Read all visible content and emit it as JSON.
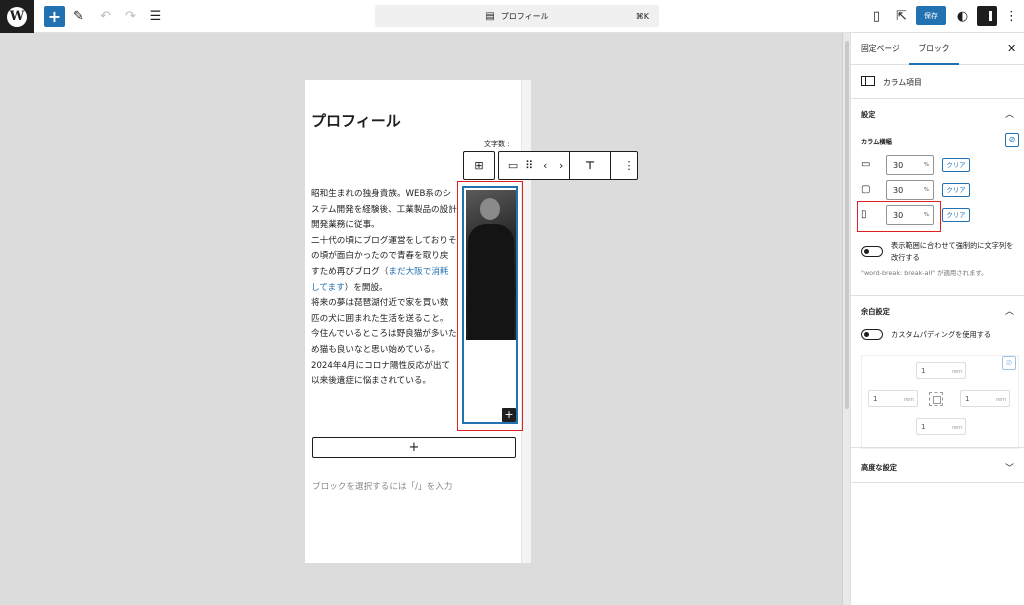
{
  "topbar": {
    "logo_letter": "W",
    "add_symbol": "+",
    "doc_title": "プロフィール",
    "shortcut": "⌘K",
    "save_label": "保存"
  },
  "editor": {
    "page_title": "プロフィール",
    "word_count_label": "文字数 :",
    "profile_paragraphs": [
      "昭和生まれの独身貴族。WEB系のシステム開発を経験後、工業製品の設計開発業務に従事。",
      "二十代の頃にブログ運営をしておりその頃が面白かったので青春を取り戻すため再びブログ（",
      "まだ大阪で消耗してます",
      "）を開設。",
      "将来の夢は琵琶湖付近で家を買い数匹の犬に囲まれた生活を送ること。",
      "今住んでいるところは野良猫が多いため猫も良いなと思い始めている。",
      "2024年4月にコロナ陽性反応が出て以来後遺症に悩まされている。"
    ],
    "column_add_symbol": "+",
    "appender_symbol": "+",
    "placeholder": "ブロックを選択するには「/」を入力"
  },
  "sidebar": {
    "tab_page": "固定ページ",
    "tab_block": "ブロック",
    "close_symbol": "✕",
    "block_name": "カラム項目",
    "settings_title": "設定",
    "column_width_label": "カラム横幅",
    "widths": [
      {
        "device": "desktop",
        "value": "30",
        "unit": "%",
        "clear": "クリア"
      },
      {
        "device": "tablet",
        "value": "30",
        "unit": "%",
        "clear": "クリア"
      },
      {
        "device": "mobile",
        "value": "30",
        "unit": "%",
        "clear": "クリア"
      }
    ],
    "wordbreak_toggle_label": "表示範囲に合わせて強制的に文字列を改行する",
    "wordbreak_help": "\"word-break: break-all\" が適用されます。",
    "padding_title": "余白設定",
    "custom_padding_label": "カスタムパディングを使用する",
    "padding": {
      "top": {
        "value": "1",
        "unit": "rem"
      },
      "left": {
        "value": "1",
        "unit": "rem"
      },
      "right": {
        "value": "1",
        "unit": "rem"
      },
      "bottom": {
        "value": "1",
        "unit": "rem"
      }
    },
    "advanced_title": "高度な設定"
  },
  "colors": {
    "accent": "#2271b1",
    "highlight_border": "#e02020"
  }
}
